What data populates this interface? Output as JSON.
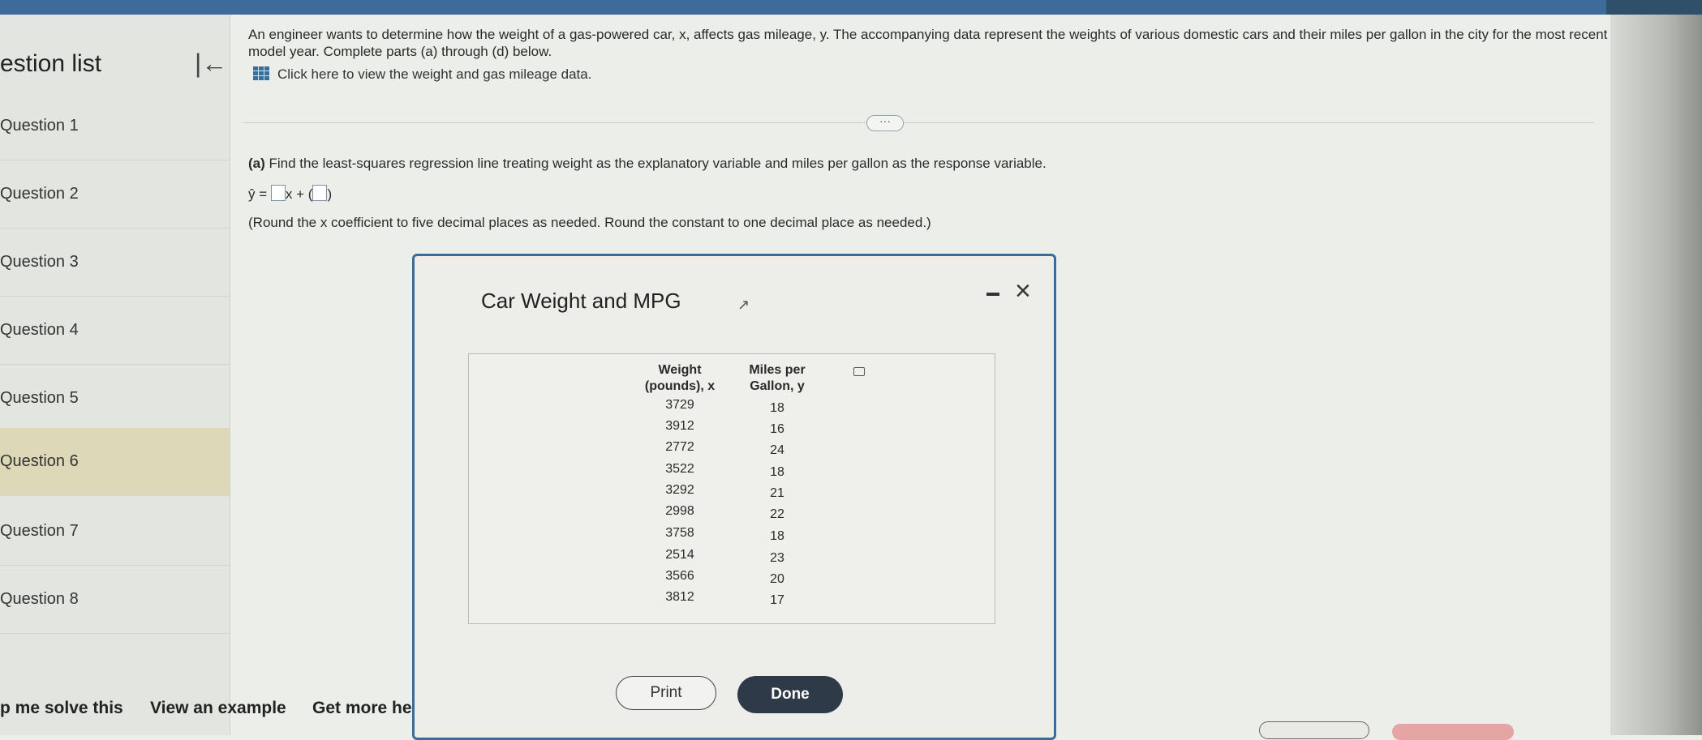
{
  "sidebar": {
    "title": "estion list",
    "items": [
      {
        "label": "Question 1"
      },
      {
        "label": "Question 2"
      },
      {
        "label": "Question 3"
      },
      {
        "label": "Question 4"
      },
      {
        "label": "Question 5"
      },
      {
        "label": "Question 6"
      },
      {
        "label": "Question 7"
      },
      {
        "label": "Question 8"
      }
    ],
    "active_index": 5
  },
  "footer": {
    "help": "p me solve this",
    "example": "View an example",
    "more": "Get more he"
  },
  "question": {
    "prompt": "An engineer wants to determine how the weight of a gas-powered car, x, affects gas mileage, y. The accompanying data represent the weights of various domestic cars and their miles per gallon in the city for the most recent model year. Complete parts (a) through (d) below.",
    "data_link": "Click here to view the weight and gas mileage data.",
    "part_a_label": "(a)",
    "part_a_text": " Find the least-squares regression line treating weight as the explanatory variable and miles per gallon as the response variable.",
    "eq_lhs": "ŷ =",
    "eq_mid": "x + (",
    "eq_end": ")",
    "round_note": "(Round the x coefficient to five decimal places as needed. Round the constant to one decimal place as needed.)"
  },
  "modal": {
    "title": "Car Weight and MPG",
    "col1_header_line1": "Weight",
    "col1_header_line2": "(pounds), x",
    "col2_header_line1": "Miles per",
    "col2_header_line2": "Gallon, y",
    "rows": [
      {
        "weight": "3729",
        "mpg": "18"
      },
      {
        "weight": "3912",
        "mpg": "16"
      },
      {
        "weight": "2772",
        "mpg": "24"
      },
      {
        "weight": "3522",
        "mpg": "18"
      },
      {
        "weight": "3292",
        "mpg": "21"
      },
      {
        "weight": "2998",
        "mpg": "22"
      },
      {
        "weight": "3758",
        "mpg": "18"
      },
      {
        "weight": "2514",
        "mpg": "23"
      },
      {
        "weight": "3566",
        "mpg": "20"
      },
      {
        "weight": "3812",
        "mpg": "17"
      }
    ],
    "print_label": "Print",
    "done_label": "Done"
  },
  "icons": {
    "collapse": "collapse-left-icon",
    "grid": "table-grid-icon",
    "minimize": "minimize-icon",
    "close": "close-icon",
    "copy": "copy-icon",
    "cursor": "mouse-cursor-icon"
  },
  "colors": {
    "accent": "#3d6c9a",
    "done_button": "#2e3a47",
    "active_item": "#ddd8b8"
  }
}
